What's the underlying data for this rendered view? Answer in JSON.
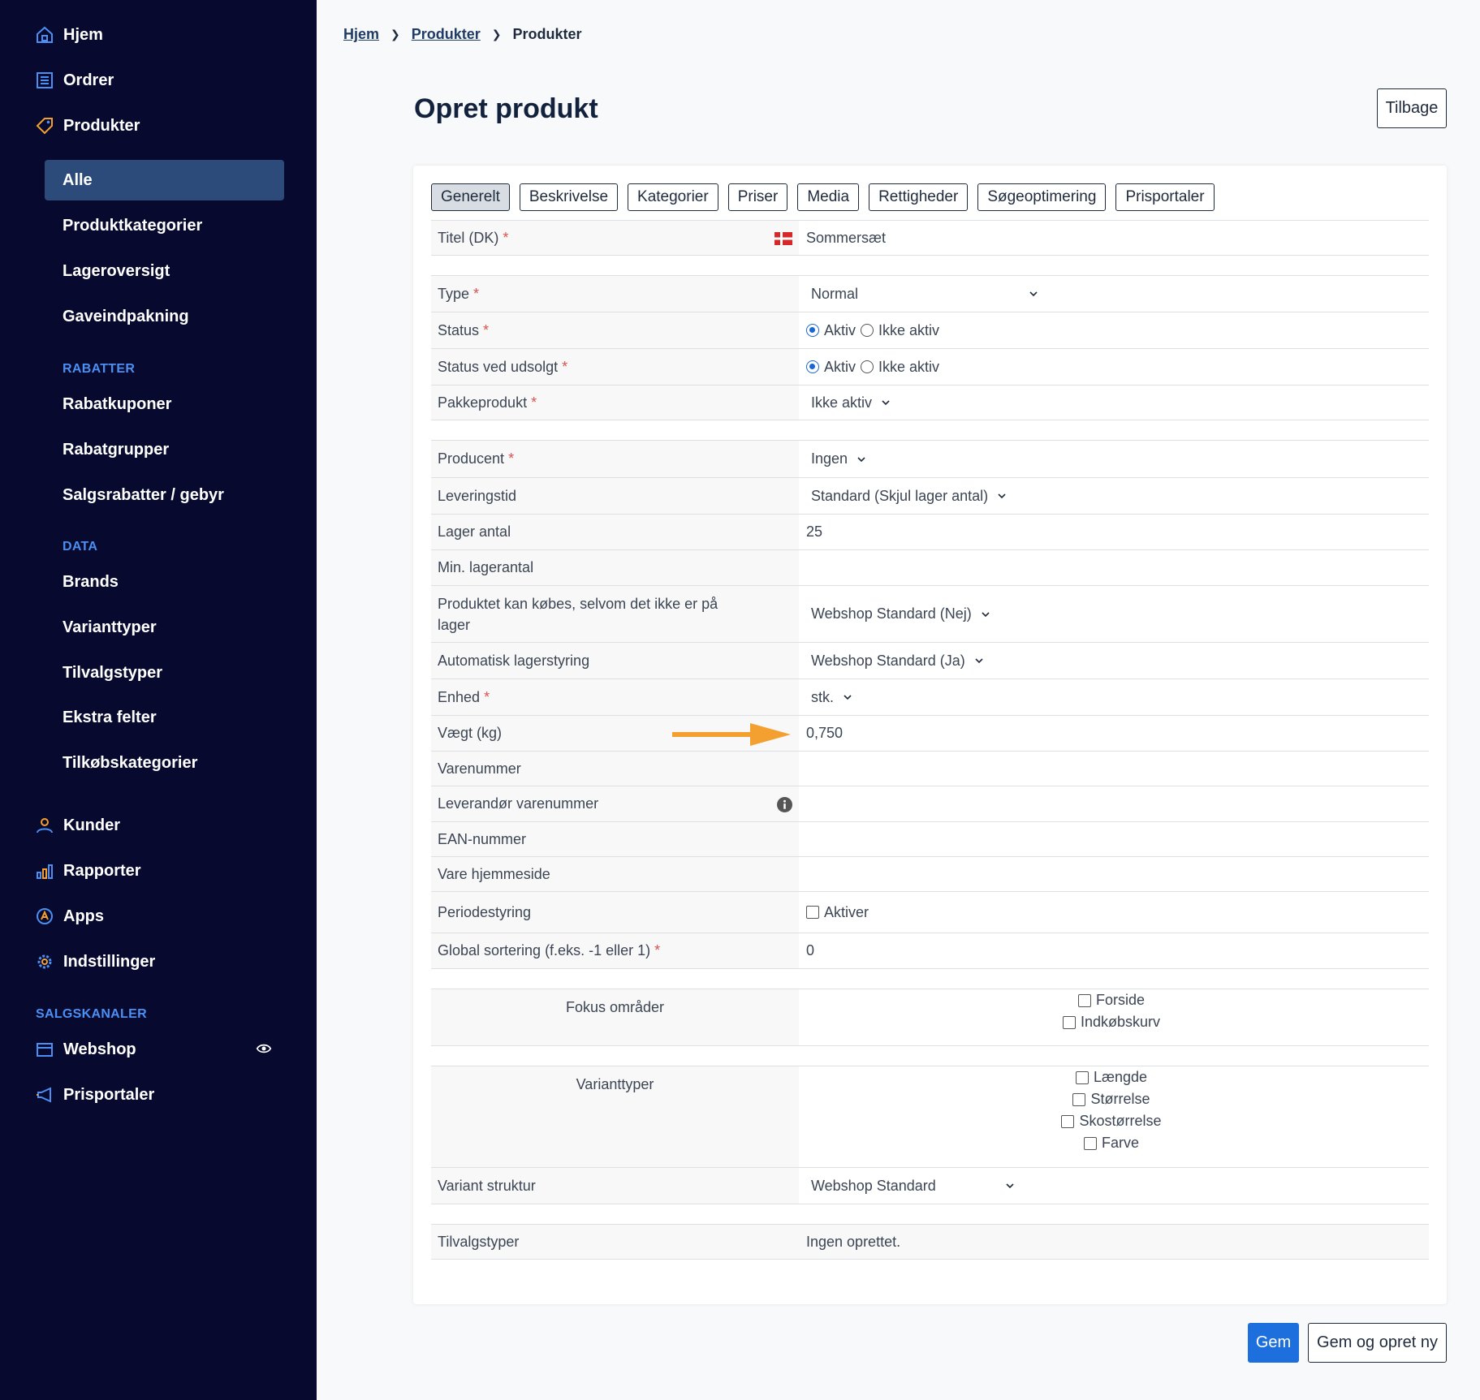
{
  "sidebar": {
    "top_items": [
      {
        "label": "Hjem",
        "icon": "home-icon"
      },
      {
        "label": "Ordrer",
        "icon": "orders-icon"
      },
      {
        "label": "Produkter",
        "icon": "tag-icon"
      }
    ],
    "product_sub": [
      "Alle",
      "Produktkategorier",
      "Lageroversigt",
      "Gaveindpakning"
    ],
    "rabatter_head": "RABATTER",
    "rabatter": [
      "Rabatkuponer",
      "Rabatgrupper",
      "Salgsrabatter / gebyr"
    ],
    "data_head": "DATA",
    "data": [
      "Brands",
      "Varianttyper",
      "Tilvalgstyper",
      "Ekstra felter",
      "Tilkøbskategorier"
    ],
    "bottom_items": [
      {
        "label": "Kunder",
        "icon": "user-icon"
      },
      {
        "label": "Rapporter",
        "icon": "chart-icon"
      },
      {
        "label": "Apps",
        "icon": "apps-icon"
      },
      {
        "label": "Indstillinger",
        "icon": "gear-icon"
      }
    ],
    "channels_head": "SALGSKANALER",
    "channels": [
      {
        "label": "Webshop",
        "icon": "store-icon"
      },
      {
        "label": "Prisportaler",
        "icon": "megaphone-icon"
      }
    ]
  },
  "breadcrumb": [
    "Hjem",
    "Produkter",
    "Produkter"
  ],
  "page_title": "Opret produkt",
  "back_label": "Tilbage",
  "tabs": [
    "Generelt",
    "Beskrivelse",
    "Kategorier",
    "Priser",
    "Media",
    "Rettigheder",
    "Søgeoptimering",
    "Prisportaler"
  ],
  "form": {
    "title_label": "Titel (DK)",
    "title_value": "Sommersæt",
    "type_label": "Type",
    "type_value": "Normal",
    "status_label": "Status",
    "status_ved_label": "Status ved udsolgt",
    "aktiv": "Aktiv",
    "ikke_aktiv": "Ikke aktiv",
    "pakke_label": "Pakkeprodukt",
    "pakke_value": "Ikke aktiv",
    "producent_label": "Producent",
    "producent_value": "Ingen",
    "levering_label": "Leveringstid",
    "levering_value": "Standard (Skjul lager antal)",
    "lager_label": "Lager antal",
    "lager_value": "25",
    "minlager_label": "Min. lagerantal",
    "kobes_label": "Produktet kan købes, selvom det ikke er på lager",
    "kobes_value": "Webshop Standard (Nej)",
    "autolager_label": "Automatisk lagerstyring",
    "autolager_value": "Webshop Standard (Ja)",
    "enhed_label": "Enhed",
    "enhed_value": "stk.",
    "vaegt_label": "Vægt (kg)",
    "vaegt_value": "0,750",
    "varenummer_label": "Varenummer",
    "levvarenr_label": "Leverandør varenummer",
    "ean_label": "EAN-nummer",
    "hjemmeside_label": "Vare hjemmeside",
    "periode_label": "Periodestyring",
    "periode_option": "Aktiver",
    "sortering_label": "Global sortering (f.eks. -1 eller 1)",
    "sortering_value": "0",
    "fokus_label": "Fokus områder",
    "fokus_options": [
      "Forside",
      "Indkøbskurv"
    ],
    "varianttyper_label": "Varianttyper",
    "varianttyper_options": [
      "Længde",
      "Størrelse",
      "Skostørrelse",
      "Farve"
    ],
    "variantstruktur_label": "Variant struktur",
    "variantstruktur_value": "Webshop Standard",
    "tilvalg_label": "Tilvalgstyper",
    "tilvalg_value": "Ingen oprettet.",
    "required_mark": "*"
  },
  "buttons": {
    "save": "Gem",
    "save_new": "Gem og opret ny"
  },
  "colors": {
    "sidebar": "#070a2e",
    "accent": "#1e6fde",
    "section_head": "#4b8ff2",
    "arrow": "#f4a030",
    "icon": "#4b8ff2"
  }
}
